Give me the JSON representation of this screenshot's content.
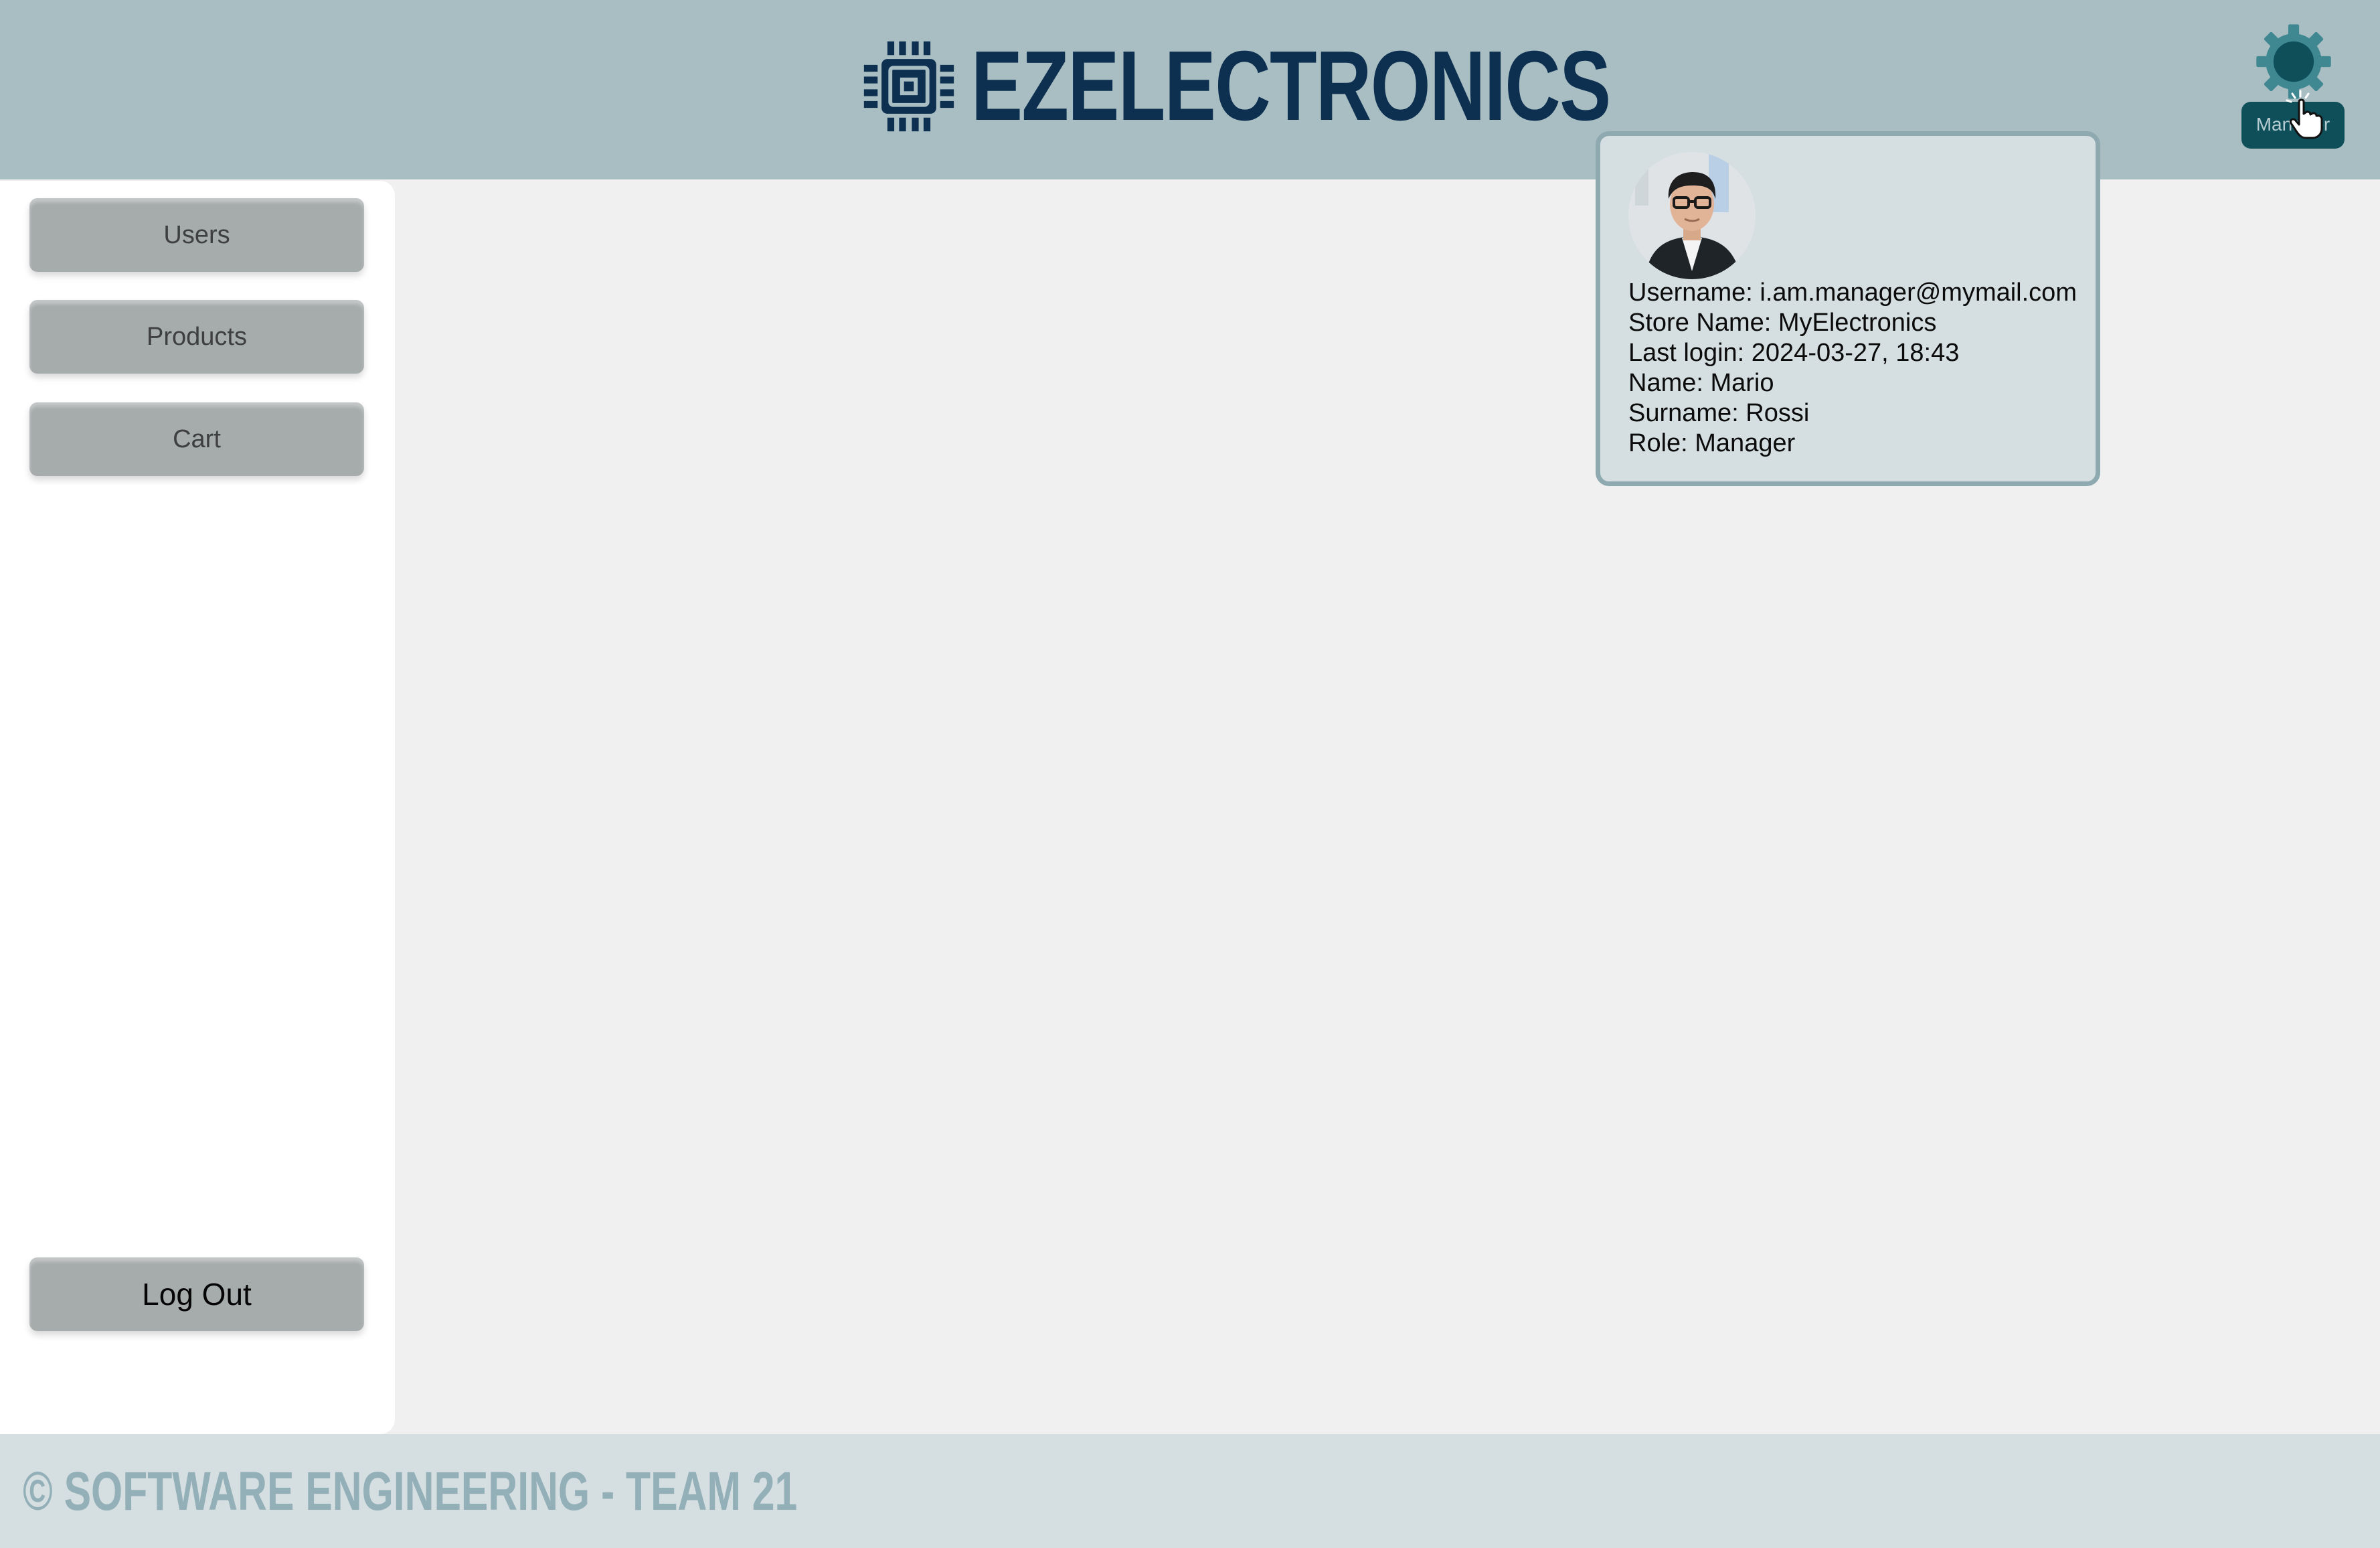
{
  "header": {
    "brand": "EZELECTRONICS",
    "logo_icon": "chip-icon",
    "profile_button": {
      "label": "Manager",
      "icon": "gear-icon"
    }
  },
  "sidebar": {
    "items": [
      {
        "label": "Users"
      },
      {
        "label": "Products"
      },
      {
        "label": "Cart"
      }
    ],
    "logout_label": "Log Out"
  },
  "profile_popup": {
    "avatar_icon": "user-avatar",
    "username": "Username: i.am.manager@mymail.com",
    "store_name": "Store Name: MyElectronics",
    "last_login": "Last login: 2024-03-27, 18:43",
    "name": "Name: Mario",
    "surname": "Surname: Rossi",
    "role": "Role: Manager"
  },
  "footer": {
    "text": "© SOFTWARE ENGINEERING - TEAM 21"
  },
  "colors": {
    "header_bg": "#a8bec3",
    "brand": "#0e3050",
    "accent_dark": "#0e4f5a",
    "button_bg": "#a6abab",
    "footer_bg": "#d5dee1",
    "footer_text": "#93b0b8"
  }
}
